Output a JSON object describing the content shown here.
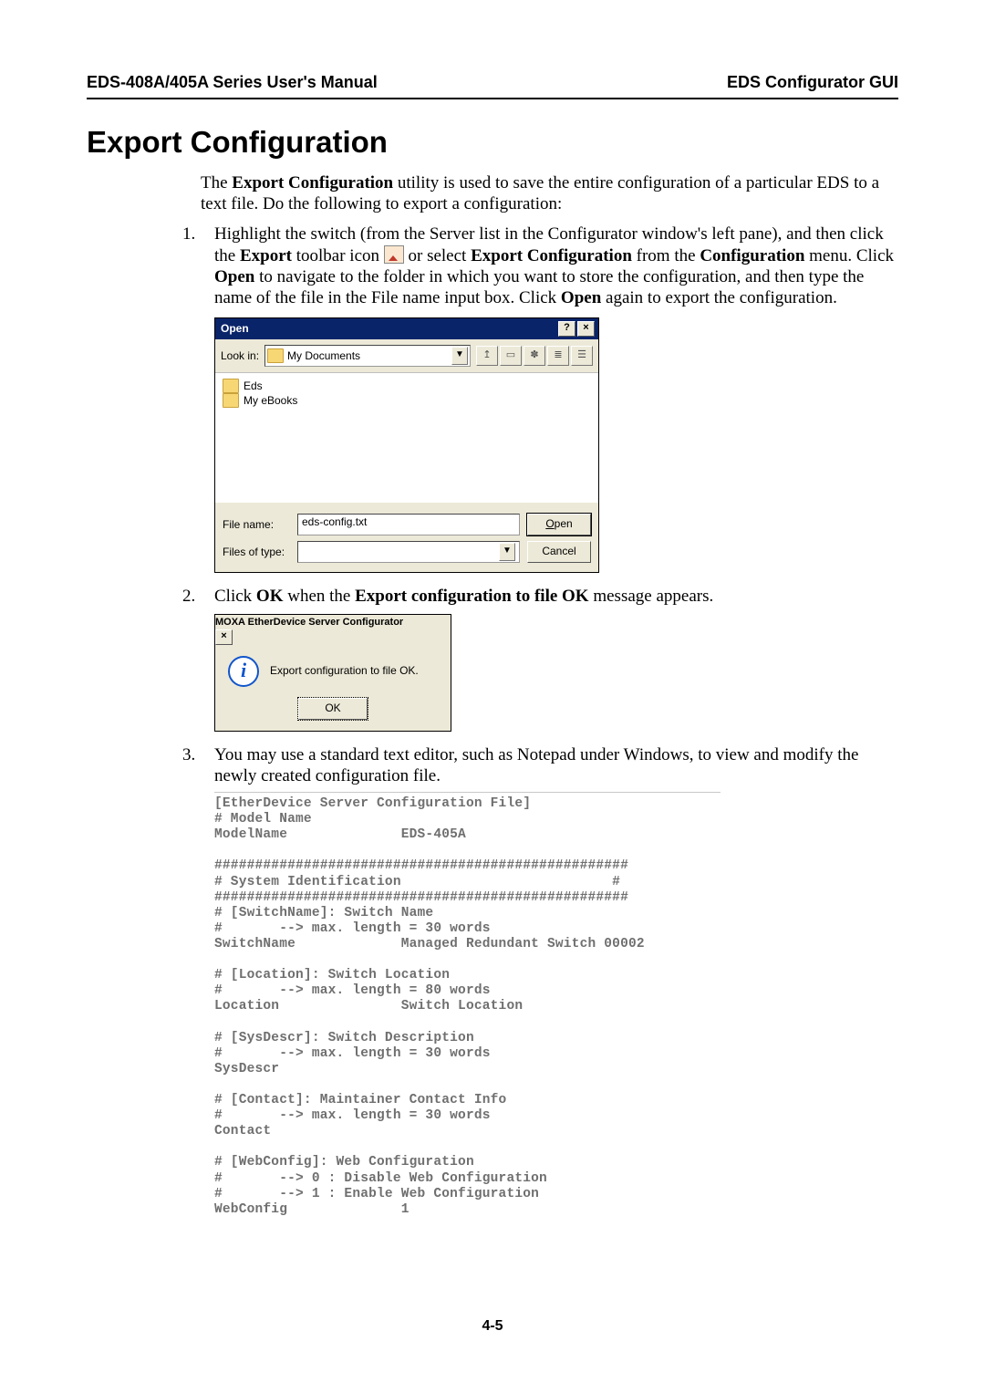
{
  "header": {
    "left": "EDS-408A/405A Series User's Manual",
    "right": "EDS Configurator GUI"
  },
  "section_title": "Export Configuration",
  "intro": {
    "l1_a": "The ",
    "l1_b": "Export Configuration",
    "l1_c": " utility is used to save the entire configuration of a particular EDS to a text file. Do the following to export a configuration:"
  },
  "steps": {
    "s1": {
      "a": "Highlight the switch (from the Server list in the Configurator window's left pane), and then click the ",
      "b": "Export",
      "c": " toolbar icon ",
      "d": " or select ",
      "e": "Export Configuration",
      "f": " from the ",
      "g": "Configuration",
      "h": " menu. Click ",
      "i": "Open",
      "j": " to navigate to the folder in which you want to store the configuration, and then type the name of the file in the File name input box. Click ",
      "k": "Open",
      "l": " again to export the configuration."
    },
    "s2": {
      "a": "Click ",
      "b": "OK",
      "c": " when the ",
      "d": "Export configuration to file OK",
      "e": " message appears."
    },
    "s3": "You may use a standard text editor, such as Notepad under Windows, to view and modify the newly created configuration file."
  },
  "open_dialog": {
    "title": "Open",
    "help_btn": "?",
    "close_btn": "×",
    "lookin_label": "Look in:",
    "lookin_value": "My Documents",
    "tool_icons": {
      "up": "↥",
      "desk": "▭",
      "newf": "✽",
      "list": "≣",
      "det": "☰"
    },
    "files": {
      "item1": "Eds",
      "item2": "My eBooks"
    },
    "filename_label": "File name:",
    "filename_value": "eds-config.txt",
    "filetype_label": "Files of type:",
    "filetype_value": "",
    "open_btn": "Open",
    "cancel_btn": "Cancel"
  },
  "confirm_dialog": {
    "title": "MOXA EtherDevice Server Configurator",
    "close_btn": "×",
    "message": "Export configuration to file OK.",
    "ok_btn": "OK"
  },
  "config_file": "[EtherDevice Server Configuration File]\n# Model Name\nModelName              EDS-405A\n\n###################################################\n# System Identification                          #\n###################################################\n# [SwitchName]: Switch Name\n#       --> max. length = 30 words\nSwitchName             Managed Redundant Switch 00002\n\n# [Location]: Switch Location\n#       --> max. length = 80 words\nLocation               Switch Location\n\n# [SysDescr]: Switch Description\n#       --> max. length = 30 words\nSysDescr\n\n# [Contact]: Maintainer Contact Info\n#       --> max. length = 30 words\nContact\n\n# [WebConfig]: Web Configuration\n#       --> 0 : Disable Web Configuration\n#       --> 1 : Enable Web Configuration\nWebConfig              1",
  "page_number": "4-5"
}
